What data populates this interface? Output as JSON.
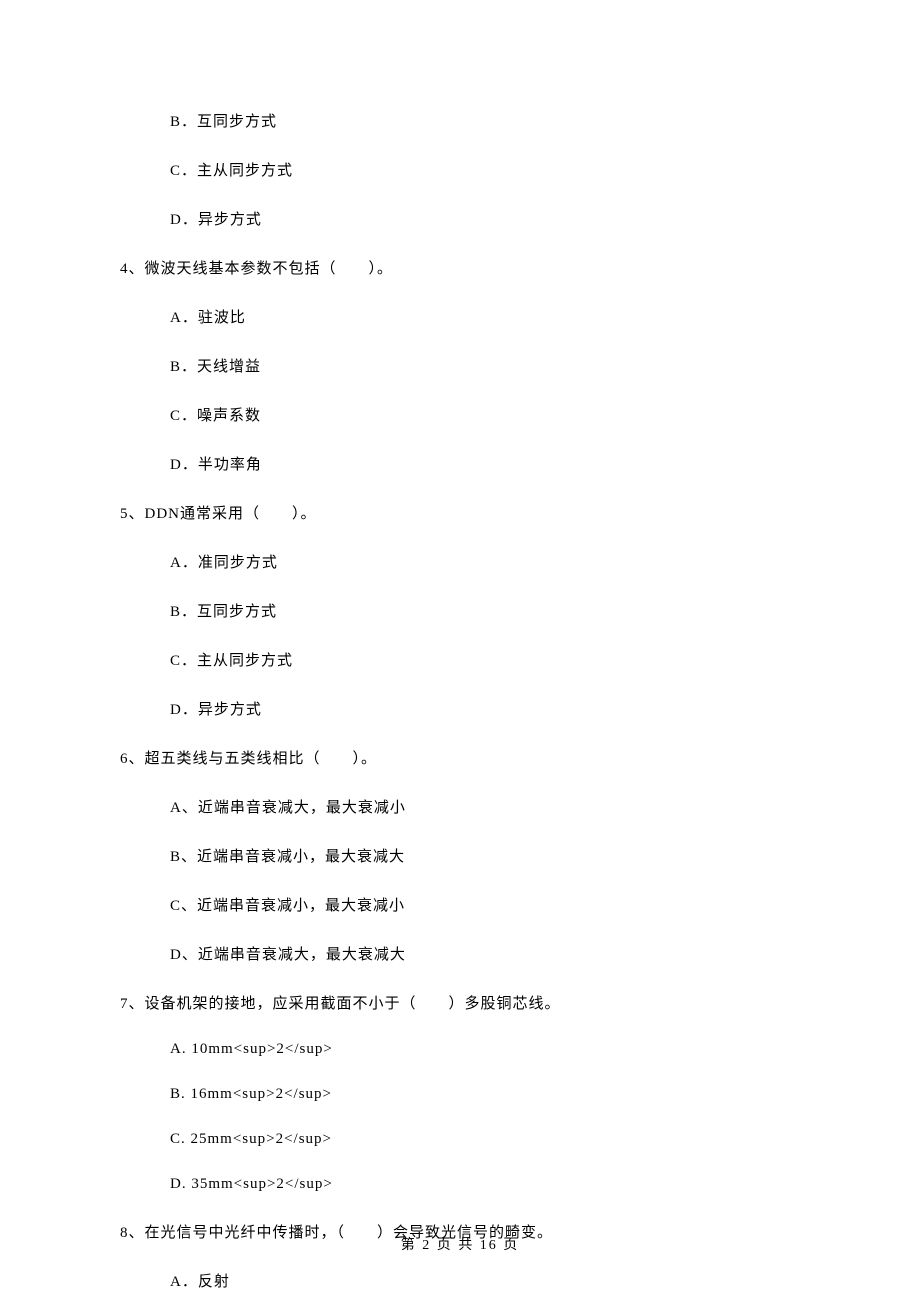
{
  "q3_options": {
    "b": "B．互同步方式",
    "c": "C．主从同步方式",
    "d": "D．异步方式"
  },
  "q4": {
    "stem": "4、微波天线基本参数不包括（　　）。",
    "a": "A．驻波比",
    "b": "B．天线增益",
    "c": "C．噪声系数",
    "d": "D．半功率角"
  },
  "q5": {
    "stem": "5、DDN通常采用（　　）。",
    "a": "A．准同步方式",
    "b": "B．互同步方式",
    "c": "C．主从同步方式",
    "d": "D．异步方式"
  },
  "q6": {
    "stem": "6、超五类线与五类线相比（　　）。",
    "a": "A、近端串音衰减大，最大衰减小",
    "b": "B、近端串音衰减小，最大衰减大",
    "c": "C、近端串音衰减小，最大衰减小",
    "d": "D、近端串音衰减大，最大衰减大"
  },
  "q7": {
    "stem": "7、设备机架的接地，应采用截面不小于（　　）多股铜芯线。",
    "a": "A. 10mm<sup>2</sup>",
    "b": "B. 16mm<sup>2</sup>",
    "c": "C. 25mm<sup>2</sup>",
    "d": "D. 35mm<sup>2</sup>"
  },
  "q8": {
    "stem": "8、在光信号中光纤中传播时，（　　）会导致光信号的畸变。",
    "a": "A．反射"
  },
  "footer": "第 2 页 共 16 页"
}
